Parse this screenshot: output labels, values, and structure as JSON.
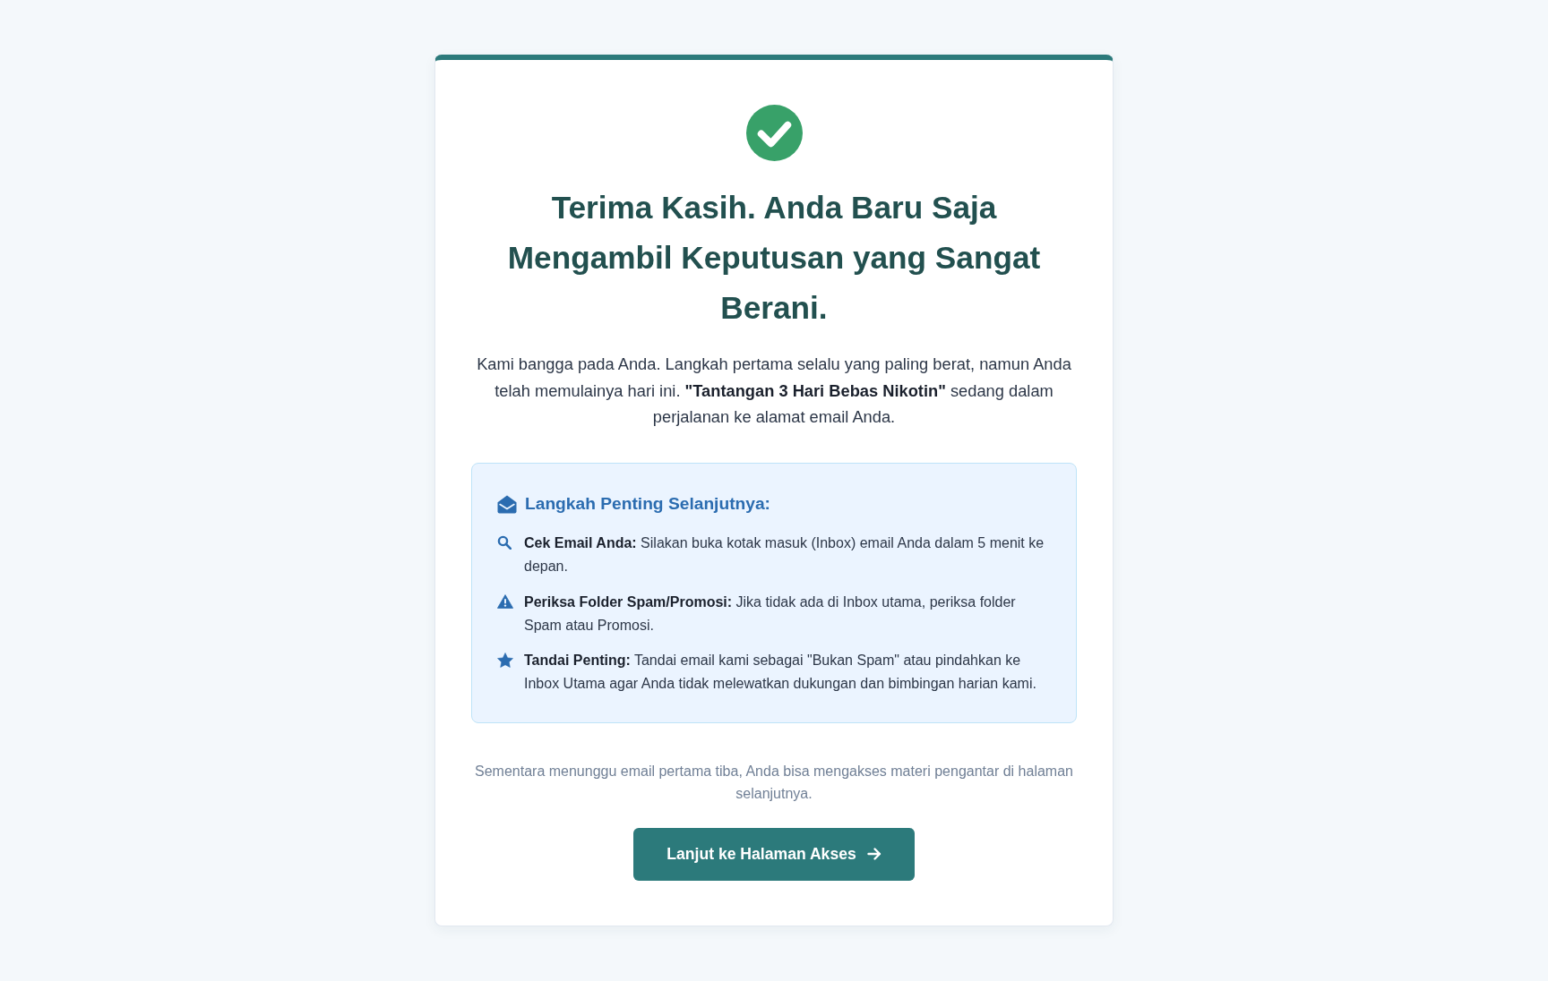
{
  "title": "Terima Kasih. Anda Baru Saja Mengambil Keputusan yang Sangat Berani.",
  "message": "Kami bangga pada Anda. Langkah pertama selalu yang paling berat, namun Anda telah memulainya hari ini. **\"Tantangan 3 Hari Bebas Nikotin\"** sedang dalam perjalanan ke alamat email Anda.",
  "next_steps": {
    "heading": "Langkah Penting Selanjutnya:",
    "items": [
      {
        "kind": "check",
        "text": "**Cek Email Anda:** Silakan buka kotak masuk (Inbox) email Anda dalam 5 menit ke depan."
      },
      {
        "kind": "alert",
        "text": "**Periksa Folder Spam/Promosi:** Jika tidak ada di Inbox utama, periksa folder Spam atau Promosi."
      },
      {
        "kind": "important",
        "text": "**Tandai Penting:** Tandai email kami sebagai \"Bukan Spam\" atau pindahkan ke Inbox Utama agar Anda tidak melewatkan dukungan dan bimbingan harian kami."
      }
    ]
  },
  "note": "Sementara menunggu email pertama tiba, Anda bisa mengakses materi pengantar di halaman selanjutnya.",
  "button": {
    "label": "Lanjut ke Halaman Akses"
  }
}
